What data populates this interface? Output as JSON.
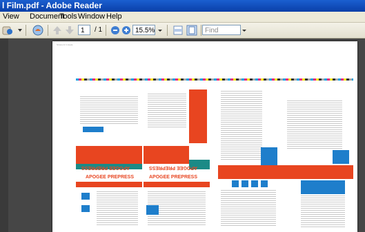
{
  "window": {
    "title": "l Film.pdf - Adobe Reader"
  },
  "menu": {
    "items": [
      "View",
      "Document",
      "Tools",
      "Window",
      "Help"
    ]
  },
  "toolbar": {
    "page_current": "1",
    "page_total": "/ 1",
    "zoom": "15.5%",
    "find_placeholder": "Find"
  },
  "document": {
    "header_text": "Strona 1z 1 kopia",
    "logo_text": "APOGEE PREPRESS",
    "logo_text_mirrored": "APOGEE PREPRESS"
  },
  "colors": {
    "accent_red": "#e84520",
    "accent_blue": "#1e7ecb",
    "accent_teal": "#1b8a86"
  }
}
